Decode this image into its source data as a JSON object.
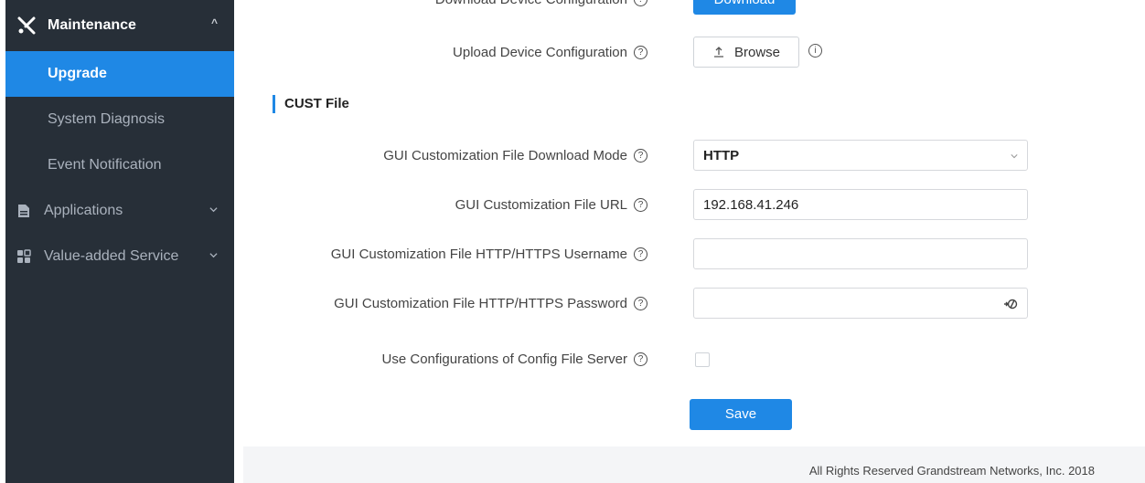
{
  "sidebar": {
    "header": {
      "label": "Maintenance",
      "icon": "tools-icon",
      "caret": "^"
    },
    "items": [
      {
        "label": "Upgrade",
        "active": true
      },
      {
        "label": "System Diagnosis",
        "active": false
      },
      {
        "label": "Event Notification",
        "active": false
      }
    ],
    "groups": [
      {
        "label": "Applications",
        "icon": "document-icon"
      },
      {
        "label": "Value-added Service",
        "icon": "grid-icon"
      }
    ]
  },
  "main": {
    "download_row": {
      "label": "Download Device Configuration",
      "button": "Download"
    },
    "upload_row": {
      "label": "Upload Device Configuration",
      "button": "Browse"
    },
    "section_title": "CUST File",
    "fields": {
      "download_mode": {
        "label": "GUI Customization File Download Mode",
        "value": "HTTP"
      },
      "url": {
        "label": "GUI Customization File URL",
        "value": "192.168.41.246"
      },
      "username": {
        "label": "GUI Customization File HTTP/HTTPS Username",
        "value": ""
      },
      "password": {
        "label": "GUI Customization File HTTP/HTTPS Password",
        "value": ""
      },
      "use_config": {
        "label": "Use Configurations of Config File Server",
        "checked": false
      }
    },
    "save_button": "Save",
    "help_glyph": "?",
    "info_glyph": "i"
  },
  "footer": {
    "text": "All Rights Reserved Grandstream Networks, Inc. 2018"
  },
  "colors": {
    "accent": "#1f88e5",
    "sidebar_bg": "#272f38"
  }
}
